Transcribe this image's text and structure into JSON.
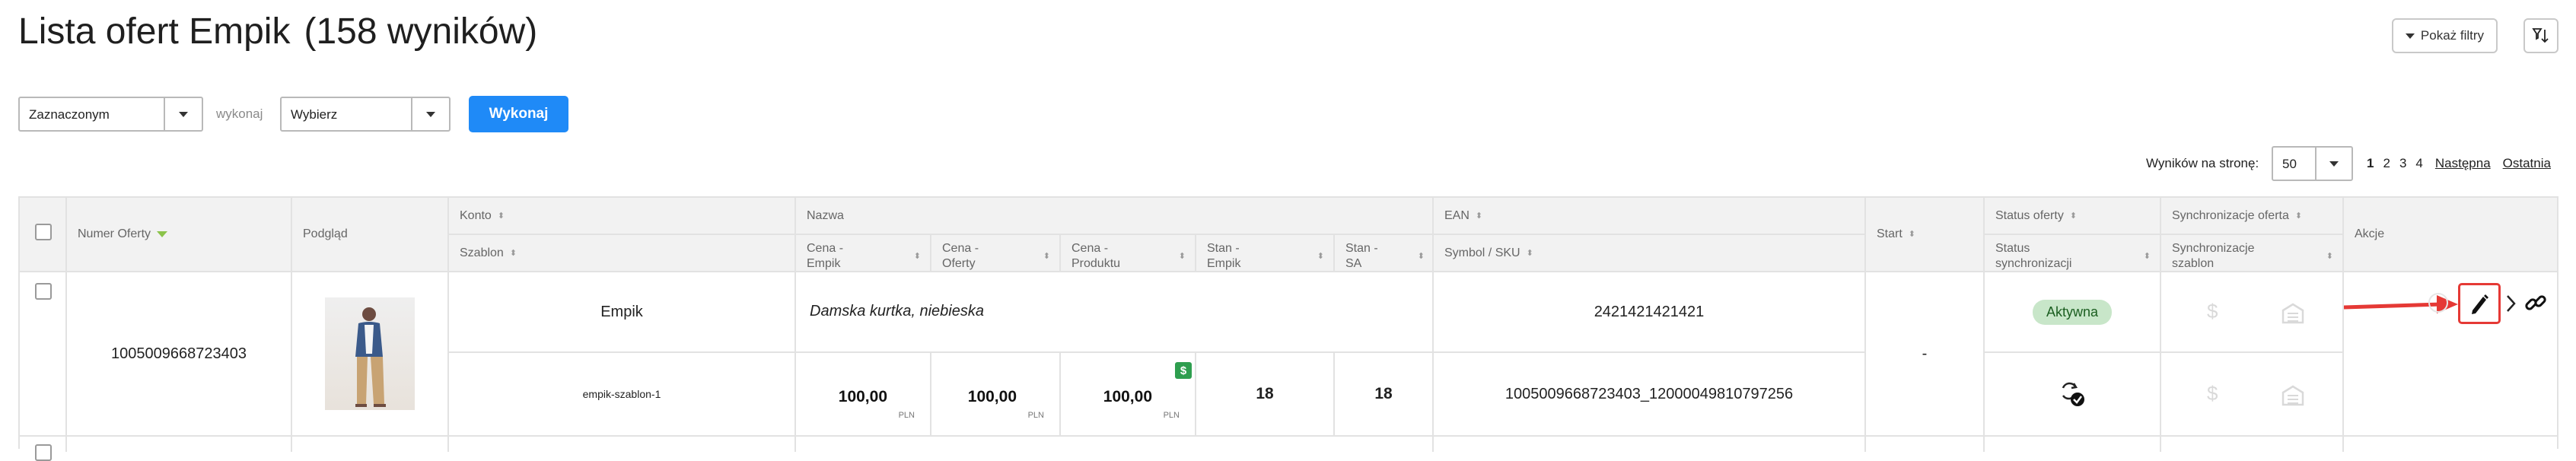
{
  "header": {
    "title": "Lista ofert Empik",
    "count": "(158 wyników)",
    "filters_button": "Pokaż filtry",
    "sort_icon": "sort-filter-icon"
  },
  "bulk_action": {
    "scope_value": "Zaznaczonym",
    "action_label": "wykonaj",
    "action_value": "Wybierz",
    "run_button": "Wykonaj"
  },
  "pagination": {
    "per_page_label": "Wyników na stronę:",
    "per_page_value": "50",
    "pages": [
      "1",
      "2",
      "3",
      "4"
    ],
    "current_page": "1",
    "next": "Następna",
    "last": "Ostatnia"
  },
  "table": {
    "headers": {
      "offer_number": "Numer Oferty",
      "preview": "Podgląd",
      "account": "Konto",
      "template": "Szablon",
      "name": "Nazwa",
      "price_empik": "Cena - Empik",
      "price_offer": "Cena - Oferty",
      "price_product": "Cena - Produktu",
      "stock_empik": "Stan - Empik",
      "stock_sa": "Stan - SA",
      "ean": "EAN",
      "symbol_sku": "Symbol / SKU",
      "start": "Start",
      "offer_status": "Status oferty",
      "sync_status": "Status synchronizacji",
      "sync_offer": "Synchronizacje oferta",
      "sync_template": "Synchronizacje szablon",
      "actions": "Akcje"
    },
    "rows": [
      {
        "offer_number": "1005009668723403",
        "account": "Empik",
        "template": "empik-szablon-1",
        "name": "Damska kurtka, niebieska",
        "price_empik": "100,00",
        "price_offer": "100,00",
        "price_product": "100,00",
        "currency": "PLN",
        "stock_empik": "18",
        "stock_sa": "18",
        "ean": "2421421421421",
        "symbol_sku": "1005009668723403_12000049810797256",
        "start": "-",
        "offer_status": "Aktywna"
      }
    ]
  },
  "colors": {
    "primary": "#1f8af7",
    "active_badge_bg": "#c8e6c9",
    "highlight": "#e53935",
    "money_badge": "#2e9e4f"
  }
}
